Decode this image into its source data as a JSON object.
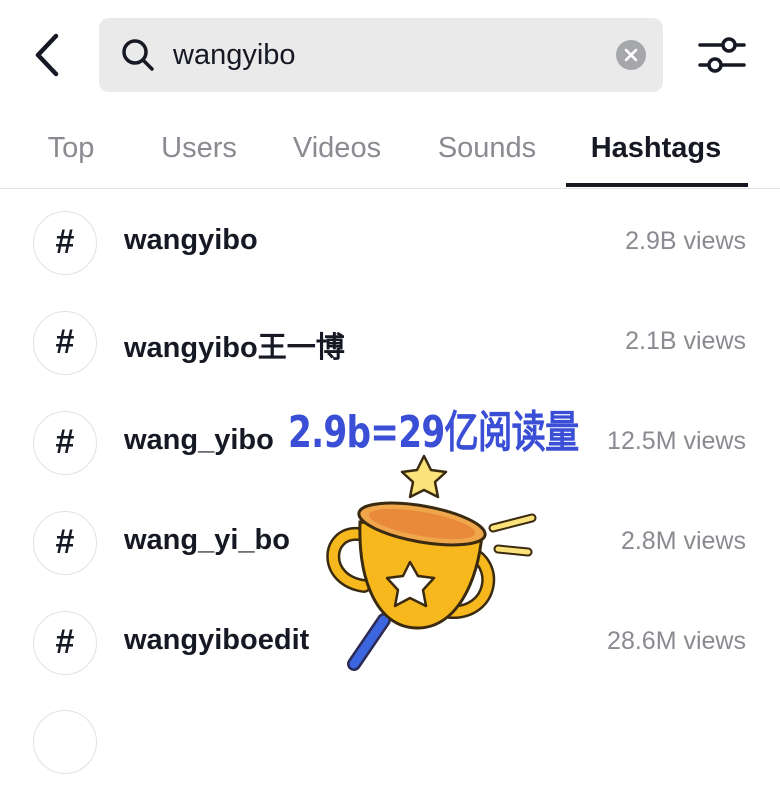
{
  "search": {
    "query": "wangyibo"
  },
  "tabs": [
    {
      "label": "Top"
    },
    {
      "label": "Users"
    },
    {
      "label": "Videos"
    },
    {
      "label": "Sounds"
    },
    {
      "label": "Hashtags",
      "active": true
    }
  ],
  "hashtags": [
    {
      "symbol": "#",
      "name": "wangyibo",
      "views": "2.9B views"
    },
    {
      "symbol": "#",
      "name": "wangyibo王一博",
      "views": "2.1B views"
    },
    {
      "symbol": "#",
      "name": "wang_yibo",
      "views": "12.5M views"
    },
    {
      "symbol": "#",
      "name": "wang_yi_bo",
      "views": "2.8M views"
    },
    {
      "symbol": "#",
      "name": "wangyiboedit",
      "views": "28.6M views"
    }
  ],
  "overlay": {
    "caption": "2.9b=29亿阅读量"
  },
  "colors": {
    "text_primary": "#161823",
    "text_secondary": "#8a8b91",
    "search_bg": "#eaeaeb",
    "caption": "#3a4fd6",
    "trophy_gold": "#f6b81c"
  },
  "icons": [
    "back-arrow-icon",
    "search-icon",
    "clear-icon",
    "filter-sliders-icon",
    "hashtag-icon",
    "trophy-sticker"
  ]
}
